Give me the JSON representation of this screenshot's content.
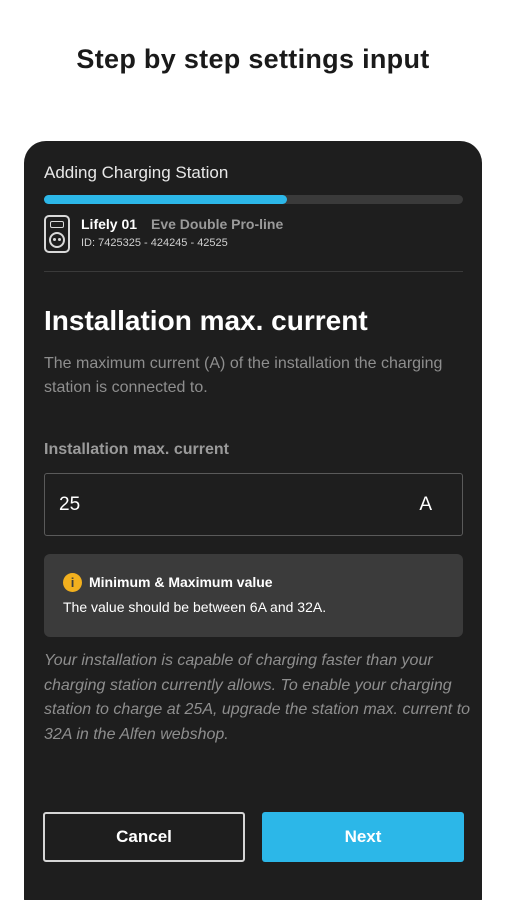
{
  "caption": "Step by step settings input",
  "header": {
    "title": "Adding Charging Station",
    "progress": 0.58
  },
  "station": {
    "name": "Lifely 01",
    "model": "Eve Double Pro-line",
    "id": "ID: 7425325 - 424245 - 42525",
    "icon": "charging-station-icon"
  },
  "main": {
    "title": "Installation max. current",
    "description": "The maximum current (A) of the installation the charging station is connected to.",
    "field": {
      "label": "Installation max. current",
      "value": "25",
      "unit": "A"
    },
    "info": {
      "icon": "info-icon",
      "icon_glyph": "i",
      "title": "Minimum & Maximum value",
      "text": "The value should be between 6A and 32A."
    },
    "note": "Your installation is capable of charging faster than your charging station currently allows. To enable your charging station to charge at 25A, upgrade the station max. current to 32A in the Alfen webshop."
  },
  "buttons": {
    "cancel": "Cancel",
    "next": "Next"
  },
  "colors": {
    "accent": "#2cb7e8",
    "background": "#1e1e1e",
    "info_icon": "#f2b01e"
  }
}
